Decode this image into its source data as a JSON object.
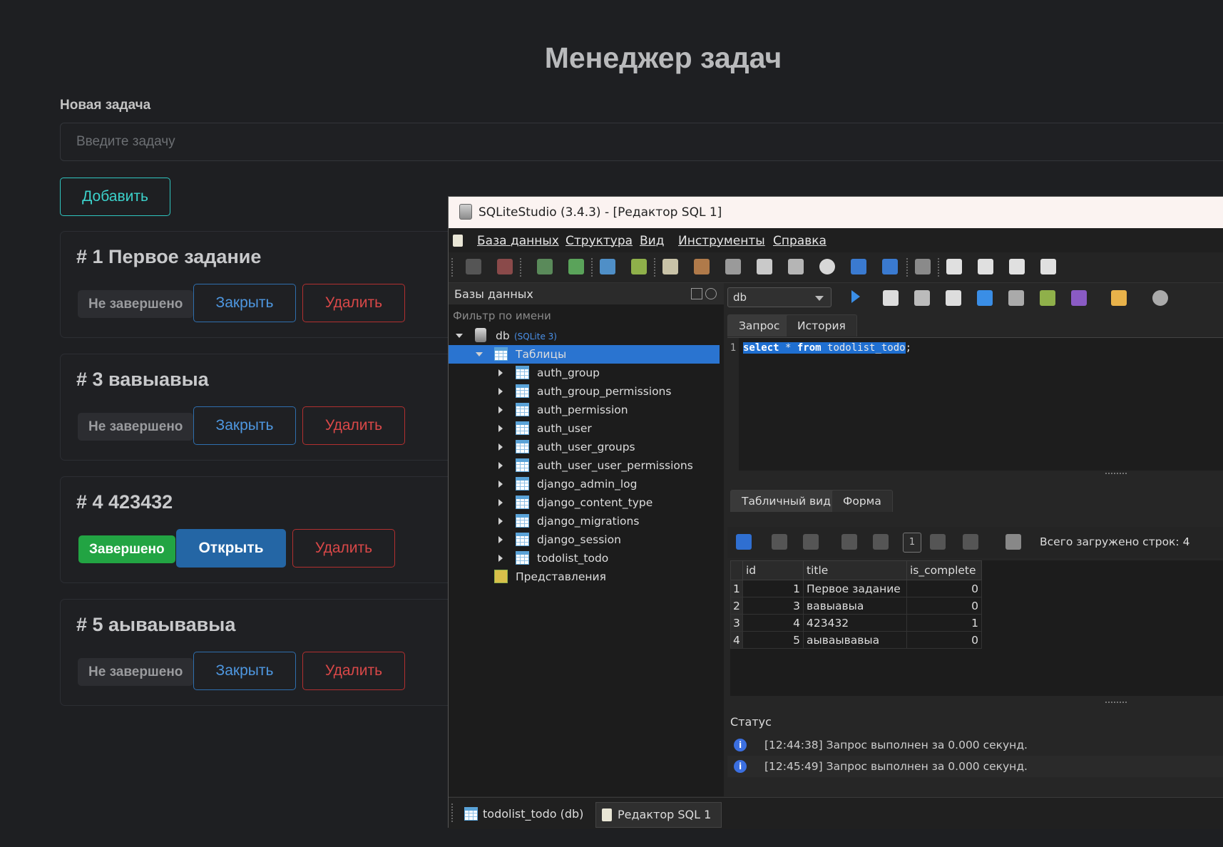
{
  "app": {
    "title": "Менеджер задач",
    "new_task_label": "Новая задача",
    "new_task_placeholder": "Введите задачу",
    "add_button": "Добавить"
  },
  "tasks": [
    {
      "title": "# 1 Первое задание",
      "status": "Не завершено",
      "toggle": "Закрыть",
      "delete": "Удалить"
    },
    {
      "title": "# 3 вавыавыа",
      "status": "Не завершено",
      "toggle": "Закрыть",
      "delete": "Удалить"
    },
    {
      "title": "# 4 423432",
      "status": "Завершено",
      "toggle": "Открыть",
      "delete": "Удалить"
    },
    {
      "title": "# 5 аываывавыа",
      "status": "Не завершено",
      "toggle": "Закрыть",
      "delete": "Удалить"
    }
  ],
  "sqlite": {
    "window_title": "SQLiteStudio (3.4.3) - [Редактор SQL 1]",
    "menu": [
      "База данных",
      "Структура",
      "Вид",
      "Инструменты",
      "Справка"
    ],
    "db_panel": {
      "title": "Базы данных",
      "filter_placeholder": "Фильтр по имени",
      "db_name": "db",
      "db_type": "(SQLite 3)",
      "tables_label": "Таблицы",
      "tables": [
        "auth_group",
        "auth_group_permissions",
        "auth_permission",
        "auth_user",
        "auth_user_groups",
        "auth_user_user_permissions",
        "django_admin_log",
        "django_content_type",
        "django_migrations",
        "django_session",
        "todolist_todo"
      ],
      "views_label": "Представления"
    },
    "editor": {
      "db_select": "db",
      "tabs": [
        "Запрос",
        "История"
      ],
      "line_number": "1",
      "sql_kw1": "select",
      "sql_mid": " * ",
      "sql_kw2": "from",
      "sql_table": " todolist_todo",
      "sql_end": ";"
    },
    "results": {
      "tabs": [
        "Табличный вид",
        "Форма"
      ],
      "page": "1",
      "row_count": "Всего загружено строк: 4",
      "columns": [
        "id",
        "title",
        "is_complete"
      ],
      "rows": [
        [
          "1",
          "1",
          "Первое задание",
          "0"
        ],
        [
          "2",
          "3",
          "вавыавыа",
          "0"
        ],
        [
          "3",
          "4",
          "423432",
          "1"
        ],
        [
          "4",
          "5",
          "аываывавыа",
          "0"
        ]
      ]
    },
    "status": {
      "title": "Статус",
      "messages": [
        {
          "time": "[12:44:38]",
          "text": "Запрос выполнен за 0.000 секунд."
        },
        {
          "time": "[12:45:49]",
          "text": "Запрос выполнен за 0.000 секунд."
        }
      ]
    },
    "bottom_tabs": [
      "todolist_todo (db)",
      "Редактор SQL 1"
    ]
  }
}
